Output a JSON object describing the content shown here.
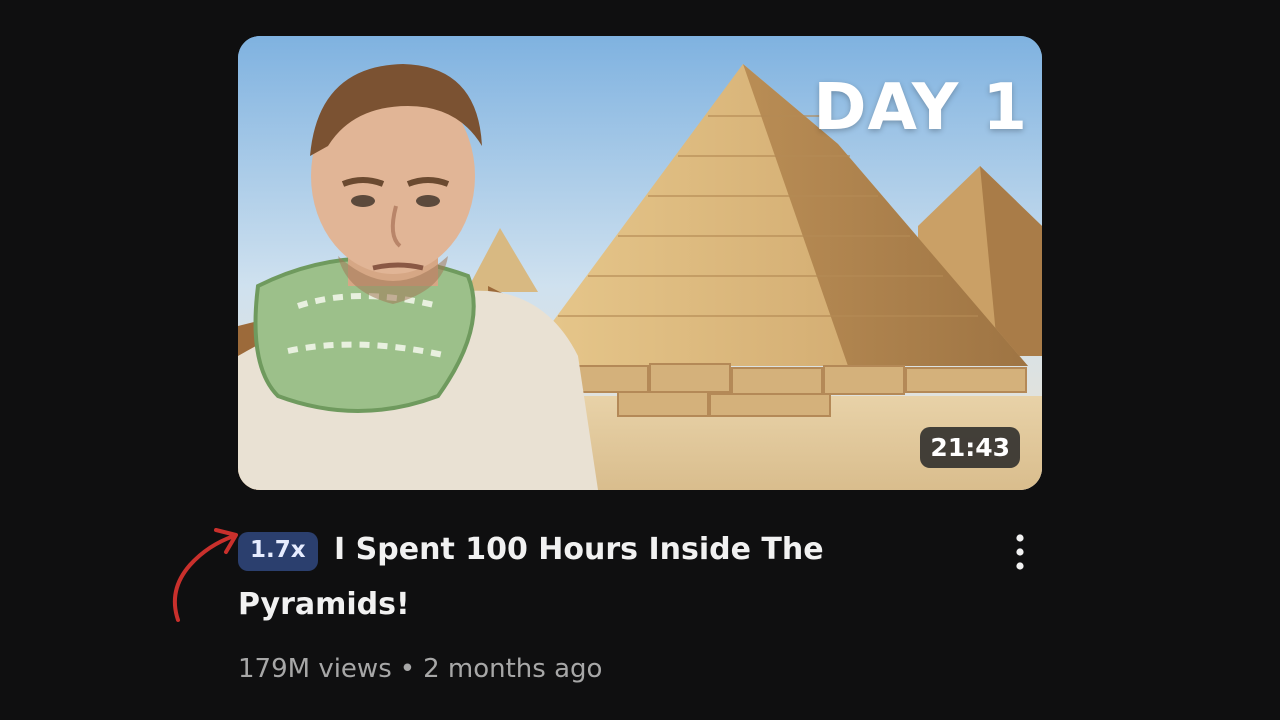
{
  "video": {
    "thumbnail_text": "DAY 1",
    "duration": "21:43",
    "speed_badge": "1.7x",
    "title": "I Spent 100 Hours Inside The Pyramids!",
    "views": "179M views",
    "separator": "•",
    "age": "2 months ago"
  },
  "icons": {
    "more": "more-vertical-icon",
    "annotation": "red-curved-arrow-icon"
  },
  "colors": {
    "background": "#0f0f10",
    "badge_bg": "#2b3f6e",
    "annotation_red": "#c9302c"
  }
}
